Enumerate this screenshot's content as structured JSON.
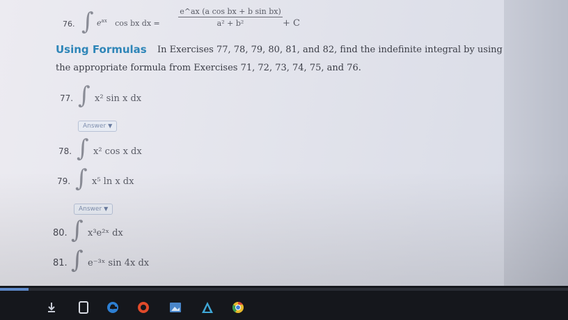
{
  "exercise76": {
    "number": "76.",
    "integrand": "e",
    "integrand_sup": "ax",
    "integrand_rest": "cos bx dx =",
    "numerator": "e^ax (a cos bx + b sin bx)",
    "denominator": "a² + b²",
    "constant": "+ C"
  },
  "section": {
    "heading": "Using Formulas",
    "instructions_line1": "In Exercises 77, 78, 79, 80, 81, and 82, find the indefinite integral by using",
    "instructions_line2": "the appropriate formula from Exercises 71, 72, 73, 74, 75, and 76."
  },
  "exercises": [
    {
      "number": "77.",
      "expr": "x² sin x dx"
    },
    {
      "number": "78.",
      "expr": "x² cos x dx"
    },
    {
      "number": "79.",
      "expr": "x⁵ ln x dx"
    },
    {
      "number": "80.",
      "expr": "x³e²ˣ dx"
    },
    {
      "number": "81.",
      "expr": "e⁻³ˣ sin 4x dx"
    }
  ],
  "answer_label": "Answer",
  "progress_fraction": 0.05,
  "colors": {
    "heading": "#2f86b8",
    "answer_text": "#7f8fae"
  },
  "taskbar_icons": [
    "download-icon",
    "tablet-icon",
    "edge-browser-icon",
    "office-icon",
    "photos-icon",
    "artwork-icon",
    "chrome-icon"
  ]
}
